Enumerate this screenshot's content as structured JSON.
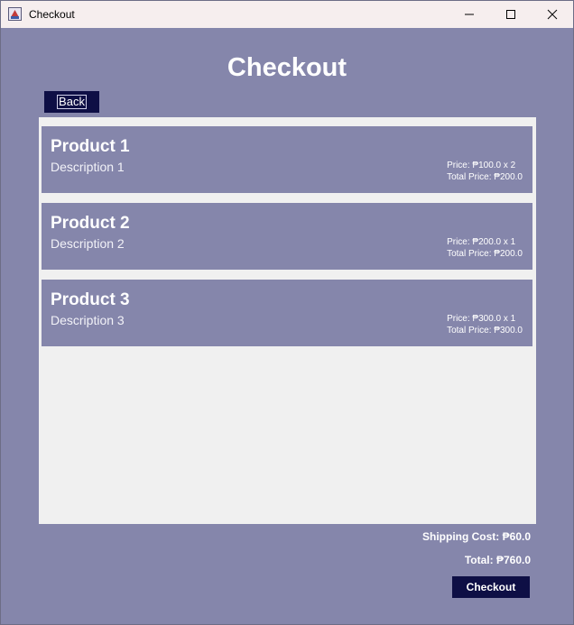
{
  "window": {
    "title": "Checkout",
    "icon": "java-app-icon",
    "controls": [
      "minimize-icon",
      "maximize-icon",
      "close-icon"
    ]
  },
  "header": {
    "title": "Checkout",
    "back_label": "Back"
  },
  "products": [
    {
      "name": "Product 1",
      "description": "Description 1",
      "price_line": "Price: ₱100.0 x 2",
      "total_line": "Total Price: ₱200.0"
    },
    {
      "name": "Product 2",
      "description": "Description 2",
      "price_line": "Price: ₱200.0 x 1",
      "total_line": "Total Price: ₱200.0"
    },
    {
      "name": "Product 3",
      "description": "Description 3",
      "price_line": "Price: ₱300.0 x 1",
      "total_line": "Total Price: ₱300.0"
    }
  ],
  "summary": {
    "shipping": "Shipping Cost: ₱60.0",
    "total": "Total: ₱760.0",
    "checkout_label": "Checkout"
  },
  "colors": {
    "background": "#8586ab",
    "button": "#0e0f45",
    "panel": "#f0f0f0",
    "titlebar": "#f6eeee"
  }
}
